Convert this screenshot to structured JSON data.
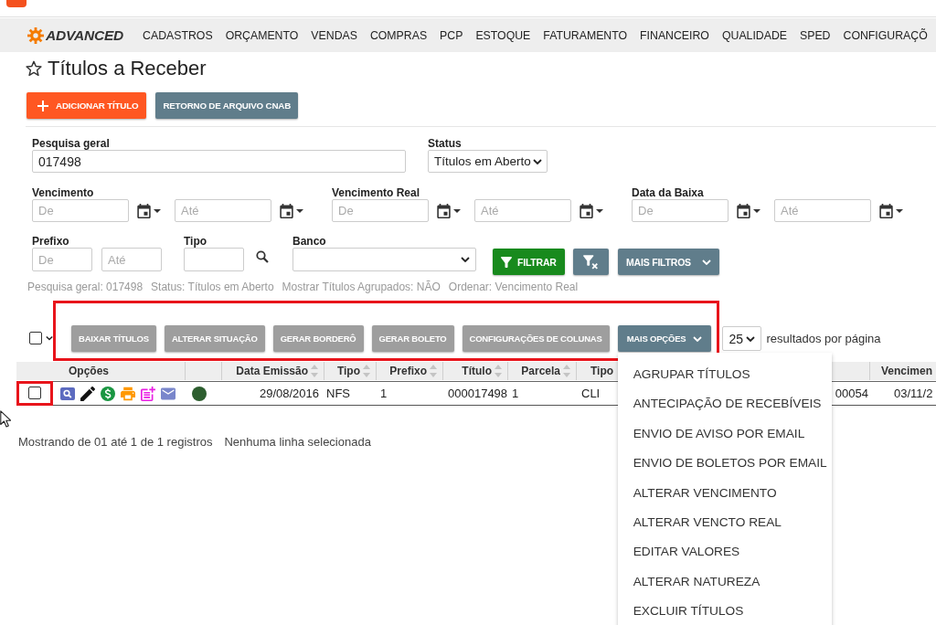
{
  "nav": {
    "brand": "ADVANCED",
    "items": [
      "CADASTROS",
      "ORÇAMENTO",
      "VENDAS",
      "COMPRAS",
      "PCP",
      "ESTOQUE",
      "FATURAMENTO",
      "FINANCEIRO",
      "QUALIDADE",
      "SPED",
      "CONFIGURAÇÕ"
    ]
  },
  "page": {
    "title": "Títulos a Receber",
    "favorite": false
  },
  "actions": [
    {
      "kind": "add",
      "label": "ADICIONAR TÍTULO"
    },
    {
      "kind": "secondary",
      "label": "RETORNO DE ARQUIVO CNAB"
    }
  ],
  "filters": {
    "search": {
      "label": "Pesquisa geral",
      "value": "017498"
    },
    "status": {
      "label": "Status",
      "value": "Títulos em Aberto"
    },
    "date_ranges": [
      {
        "label": "Vencimento",
        "placeholders": [
          "De",
          "Até"
        ]
      },
      {
        "label": "Vencimento Real",
        "placeholders": [
          "De",
          "Até"
        ]
      },
      {
        "label": "Data da Baixa",
        "placeholders": [
          "De",
          "Até"
        ]
      }
    ],
    "prefix": {
      "label": "Prefixo",
      "placeholders": [
        "De",
        "Até"
      ]
    },
    "type": {
      "label": "Tipo"
    },
    "bank": {
      "label": "Banco"
    },
    "filter_button": "FILTRAR",
    "more_filters": "MAIS FILTROS"
  },
  "summary": [
    "Pesquisa geral: 017498",
    "Status: Títulos em Aberto",
    "Mostrar Títulos Agrupados: NÃO",
    "Ordenar: Vencimento Real"
  ],
  "toolbar": {
    "select_all": {
      "checked": false
    },
    "highlighted": true,
    "actions": [
      "BAIXAR TÍTULOS",
      "ALTERAR SITUAÇÃO",
      "GERAR BORDERÔ",
      "GERAR BOLETO",
      "CONFIGURAÇÕES DE COLUNAS"
    ],
    "more_options": {
      "label": "MAIS OPÇÕES",
      "expanded": true,
      "items": [
        "AGRUPAR TÍTULOS",
        "ANTECIPAÇÃO DE RECEBÍVEIS",
        "ENVIO DE AVISO POR EMAIL",
        "ENVIO DE BOLETOS POR EMAIL",
        "ALTERAR VENCIMENTO",
        "ALTERAR VENCTO REAL",
        "EDITAR VALORES",
        "ALTERAR NATUREZA",
        "EXCLUIR TÍTULOS"
      ]
    },
    "page_size": {
      "value": "25",
      "label": "resultados por página"
    }
  },
  "table": {
    "options_header": "Opções",
    "columns": [
      {
        "label": "Data Emissão",
        "sortable": true
      },
      {
        "label": "Tipo",
        "sortable": true
      },
      {
        "label": "Prefixo",
        "sortable": true
      },
      {
        "label": "Título",
        "sortable": true
      },
      {
        "label": "Parcela",
        "sortable": true
      },
      {
        "label": "Tipo",
        "sortable": false
      },
      {},
      {
        "label": "Vencimen",
        "sortable": false
      }
    ],
    "rows": [
      {
        "checked": false,
        "highlighted": true,
        "color": "#2d5e2f",
        "cells": [
          "29/08/2016",
          "NFS",
          "1",
          "000017498",
          "1",
          "CLI",
          "00054",
          "03/11/2"
        ]
      }
    ]
  },
  "footer": {
    "info": "Mostrando de 01 até 1 de 1 registros",
    "selection": "Nenhuma linha selecionada"
  }
}
